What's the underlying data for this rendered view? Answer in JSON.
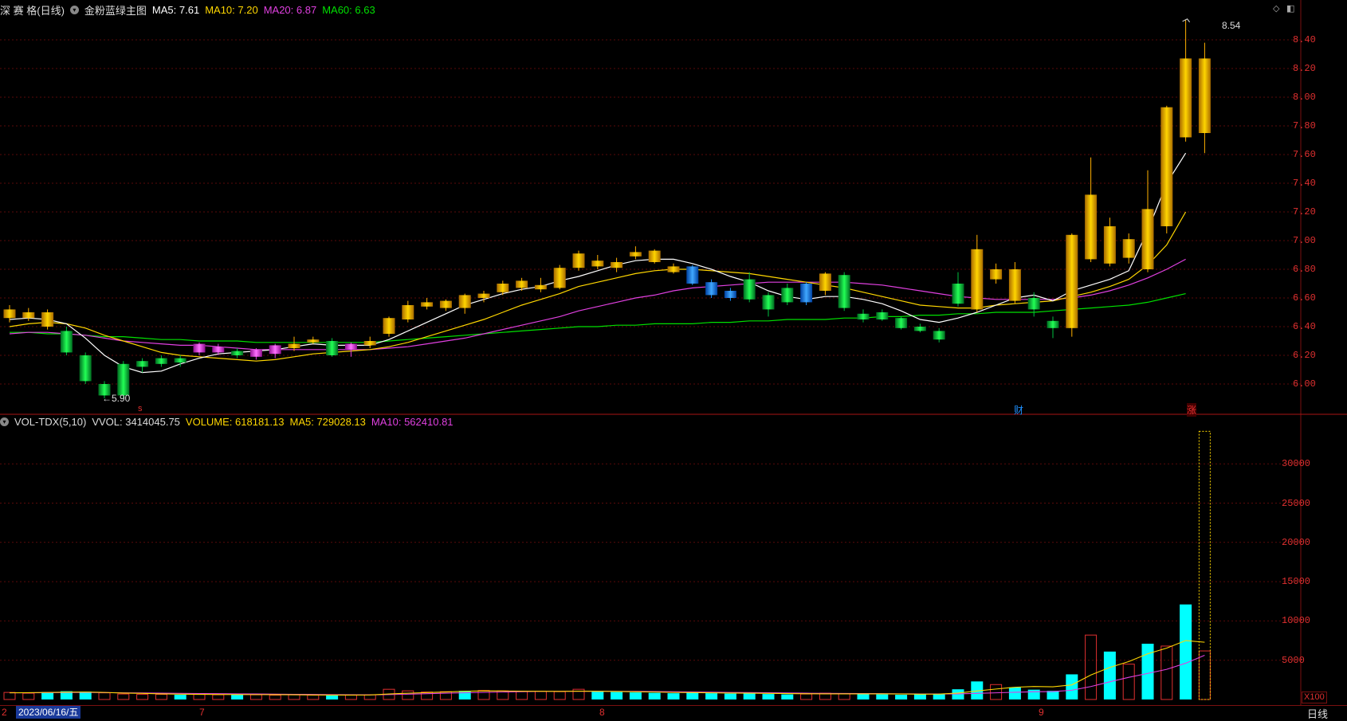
{
  "header": {
    "stock_name": "深 赛 格",
    "period_tag": "(日线)",
    "indicator_name": "金粉蓝绿主图",
    "ma5": "MA5: 7.61",
    "ma10": "MA10: 7.20",
    "ma20": "MA20: 6.87",
    "ma60": "MA60: 6.63"
  },
  "volume_header": {
    "name": "VOL-TDX(5,10)",
    "vvol": "VVOL: 3414045.75",
    "volume": "VOLUME: 618181.13",
    "ma5": "MA5: 729028.13",
    "ma10": "MA10: 562410.81"
  },
  "price_axis": [
    "8.40",
    "8.20",
    "8.00",
    "7.80",
    "7.60",
    "7.40",
    "7.20",
    "7.00",
    "6.80",
    "6.60",
    "6.40",
    "6.20",
    "6.00"
  ],
  "volume_axis": [
    "30000",
    "25000",
    "20000",
    "15000",
    "10000",
    "5000"
  ],
  "annotations": {
    "high": "8.54",
    "low": "←5.90"
  },
  "markers": {
    "m1": "s",
    "m2": "财",
    "m3": "涨"
  },
  "bottom": {
    "date": "2023/06/16/五",
    "x_first": "2",
    "x_jul": "7",
    "x_aug": "8",
    "x_sep": "9",
    "period": "日线",
    "unit": "X100"
  },
  "colors": {
    "up_gold": "#ffb000",
    "down_green": "#00c040",
    "blue": "#1e90ff",
    "magenta": "#e040e0",
    "cyan": "#00ffff",
    "grid": "#5a0a0a",
    "axis": "#e03030"
  },
  "chart_data": [
    {
      "type": "candlestick",
      "title": "深 赛 格(日线)",
      "ylim": [
        5.8,
        8.6
      ],
      "candles": [
        [
          "gold",
          6.52,
          6.46,
          6.55,
          6.43
        ],
        [
          "gold",
          6.5,
          6.46,
          6.53,
          6.44
        ],
        [
          "gold",
          6.5,
          6.4,
          6.52,
          6.38
        ],
        [
          "green",
          6.37,
          6.22,
          6.4,
          6.2
        ],
        [
          "green",
          6.2,
          6.02,
          6.22,
          6.0
        ],
        [
          "green",
          6.0,
          5.92,
          6.02,
          5.9
        ],
        [
          "green",
          6.14,
          5.92,
          6.16,
          5.9
        ],
        [
          "green",
          6.16,
          6.12,
          6.18,
          6.08
        ],
        [
          "green",
          6.18,
          6.14,
          6.2,
          6.12
        ],
        [
          "green",
          6.18,
          6.15,
          6.2,
          6.12
        ],
        [
          "magenta",
          6.22,
          6.28,
          6.29,
          6.2
        ],
        [
          "magenta",
          6.22,
          6.26,
          6.28,
          6.2
        ],
        [
          "green",
          6.23,
          6.2,
          6.25,
          6.18
        ],
        [
          "magenta",
          6.19,
          6.24,
          6.25,
          6.17
        ],
        [
          "magenta",
          6.21,
          6.27,
          6.28,
          6.18
        ],
        [
          "gold",
          6.25,
          6.28,
          6.33,
          6.23
        ],
        [
          "gold",
          6.29,
          6.31,
          6.33,
          6.28
        ],
        [
          "green",
          6.3,
          6.2,
          6.32,
          6.19
        ],
        [
          "magenta",
          6.24,
          6.28,
          6.29,
          6.19
        ],
        [
          "gold",
          6.27,
          6.3,
          6.33,
          6.25
        ],
        [
          "gold",
          6.35,
          6.46,
          6.47,
          6.33
        ],
        [
          "gold",
          6.45,
          6.55,
          6.58,
          6.43
        ],
        [
          "gold",
          6.54,
          6.57,
          6.6,
          6.52
        ],
        [
          "gold",
          6.53,
          6.58,
          6.59,
          6.51
        ],
        [
          "gold",
          6.53,
          6.62,
          6.63,
          6.49
        ],
        [
          "gold",
          6.6,
          6.63,
          6.65,
          6.57
        ],
        [
          "gold",
          6.64,
          6.7,
          6.72,
          6.62
        ],
        [
          "gold",
          6.67,
          6.72,
          6.74,
          6.65
        ],
        [
          "gold",
          6.66,
          6.69,
          6.74,
          6.64
        ],
        [
          "gold",
          6.67,
          6.81,
          6.83,
          6.66
        ],
        [
          "gold",
          6.81,
          6.91,
          6.93,
          6.79
        ],
        [
          "gold",
          6.82,
          6.86,
          6.9,
          6.8
        ],
        [
          "gold",
          6.81,
          6.85,
          6.88,
          6.78
        ],
        [
          "gold",
          6.89,
          6.92,
          6.96,
          6.87
        ],
        [
          "gold",
          6.85,
          6.93,
          6.94,
          6.84
        ],
        [
          "gold",
          6.78,
          6.82,
          6.84,
          6.77
        ],
        [
          "blue",
          6.82,
          6.7,
          6.83,
          6.69
        ],
        [
          "blue",
          6.71,
          6.62,
          6.73,
          6.6
        ],
        [
          "blue",
          6.65,
          6.6,
          6.67,
          6.58
        ],
        [
          "green",
          6.73,
          6.59,
          6.78,
          6.57
        ],
        [
          "green",
          6.62,
          6.52,
          6.64,
          6.47
        ],
        [
          "green",
          6.67,
          6.57,
          6.7,
          6.55
        ],
        [
          "blue",
          6.7,
          6.57,
          6.71,
          6.55
        ],
        [
          "gold",
          6.65,
          6.77,
          6.78,
          6.62
        ],
        [
          "green",
          6.76,
          6.53,
          6.78,
          6.51
        ],
        [
          "green",
          6.49,
          6.45,
          6.52,
          6.43
        ],
        [
          "green",
          6.5,
          6.45,
          6.52,
          6.44
        ],
        [
          "green",
          6.46,
          6.39,
          6.47,
          6.38
        ],
        [
          "green",
          6.4,
          6.37,
          6.42,
          6.36
        ],
        [
          "green",
          6.37,
          6.31,
          6.39,
          6.29
        ],
        [
          "green",
          6.7,
          6.56,
          6.78,
          6.54
        ],
        [
          "gold",
          6.52,
          6.94,
          7.04,
          6.5
        ],
        [
          "gold",
          6.73,
          6.8,
          6.84,
          6.7
        ],
        [
          "gold",
          6.58,
          6.8,
          6.85,
          6.56
        ],
        [
          "green",
          6.6,
          6.52,
          6.64,
          6.47
        ],
        [
          "green",
          6.44,
          6.39,
          6.47,
          6.32
        ],
        [
          "gold",
          6.39,
          7.04,
          7.05,
          6.33
        ],
        [
          "gold",
          6.87,
          7.32,
          7.58,
          6.85
        ],
        [
          "gold",
          6.84,
          7.1,
          7.16,
          6.82
        ],
        [
          "gold",
          6.88,
          7.01,
          7.05,
          6.84
        ],
        [
          "gold",
          6.8,
          7.22,
          7.49,
          6.78
        ],
        [
          "gold",
          7.1,
          7.93,
          7.94,
          7.05
        ],
        [
          "gold",
          7.72,
          8.27,
          8.54,
          7.69
        ],
        [
          "gold",
          7.75,
          8.27,
          8.38,
          7.61
        ]
      ],
      "ma5": [
        6.45,
        6.46,
        6.45,
        6.42,
        6.32,
        6.2,
        6.12,
        6.08,
        6.09,
        6.14,
        6.18,
        6.21,
        6.22,
        6.23,
        6.24,
        6.26,
        6.28,
        6.27,
        6.27,
        6.27,
        6.31,
        6.37,
        6.43,
        6.49,
        6.55,
        6.59,
        6.63,
        6.66,
        6.68,
        6.72,
        6.75,
        6.79,
        6.83,
        6.86,
        6.87,
        6.87,
        6.84,
        6.8,
        6.75,
        6.71,
        6.65,
        6.61,
        6.59,
        6.61,
        6.61,
        6.59,
        6.56,
        6.51,
        6.45,
        6.43,
        6.46,
        6.5,
        6.55,
        6.6,
        6.62,
        6.58,
        6.65,
        6.69,
        6.73,
        6.79,
        7.07,
        7.4,
        7.61
      ],
      "ma10": [
        6.4,
        6.42,
        6.43,
        6.42,
        6.39,
        6.34,
        6.3,
        6.26,
        6.22,
        6.2,
        6.19,
        6.18,
        6.17,
        6.16,
        6.17,
        6.19,
        6.21,
        6.22,
        6.23,
        6.24,
        6.26,
        6.29,
        6.33,
        6.37,
        6.41,
        6.45,
        6.5,
        6.55,
        6.59,
        6.63,
        6.68,
        6.71,
        6.74,
        6.77,
        6.79,
        6.8,
        6.8,
        6.79,
        6.78,
        6.77,
        6.75,
        6.73,
        6.71,
        6.69,
        6.67,
        6.64,
        6.61,
        6.58,
        6.55,
        6.54,
        6.53,
        6.53,
        6.55,
        6.56,
        6.57,
        6.58,
        6.61,
        6.64,
        6.68,
        6.73,
        6.83,
        6.97,
        7.2
      ],
      "ma20": [
        6.35,
        6.36,
        6.36,
        6.35,
        6.34,
        6.32,
        6.3,
        6.29,
        6.28,
        6.27,
        6.27,
        6.26,
        6.25,
        6.24,
        6.24,
        6.24,
        6.24,
        6.24,
        6.24,
        6.24,
        6.25,
        6.26,
        6.28,
        6.3,
        6.32,
        6.35,
        6.38,
        6.41,
        6.44,
        6.47,
        6.51,
        6.54,
        6.57,
        6.6,
        6.62,
        6.65,
        6.67,
        6.68,
        6.69,
        6.7,
        6.71,
        6.71,
        6.71,
        6.71,
        6.71,
        6.7,
        6.69,
        6.67,
        6.65,
        6.63,
        6.61,
        6.6,
        6.59,
        6.59,
        6.59,
        6.59,
        6.6,
        6.62,
        6.65,
        6.69,
        6.74,
        6.8,
        6.87
      ],
      "ma60": [
        6.36,
        6.36,
        6.35,
        6.35,
        6.34,
        6.33,
        6.33,
        6.32,
        6.31,
        6.31,
        6.3,
        6.3,
        6.3,
        6.29,
        6.29,
        6.29,
        6.29,
        6.29,
        6.29,
        6.29,
        6.3,
        6.31,
        6.32,
        6.33,
        6.34,
        6.35,
        6.36,
        6.37,
        6.38,
        6.39,
        6.4,
        6.4,
        6.41,
        6.41,
        6.42,
        6.42,
        6.42,
        6.43,
        6.43,
        6.44,
        6.44,
        6.45,
        6.45,
        6.45,
        6.46,
        6.46,
        6.47,
        6.47,
        6.48,
        6.48,
        6.49,
        6.49,
        6.5,
        6.5,
        6.5,
        6.51,
        6.52,
        6.53,
        6.54,
        6.55,
        6.57,
        6.6,
        6.63
      ]
    },
    {
      "type": "bar",
      "title": "VOL-TDX(5,10)",
      "ylim": [
        0,
        35000
      ],
      "volumes": [
        900,
        800,
        950,
        1050,
        1000,
        850,
        700,
        650,
        650,
        600,
        650,
        600,
        650,
        600,
        550,
        600,
        550,
        500,
        550,
        600,
        1300,
        1100,
        950,
        1000,
        1100,
        1150,
        1100,
        1050,
        1050,
        1000,
        1300,
        1000,
        950,
        900,
        850,
        800,
        900,
        800,
        750,
        800,
        700,
        650,
        700,
        800,
        750,
        700,
        650,
        600,
        700,
        750,
        1300,
        2300,
        1900,
        1550,
        1250,
        1100,
        3200,
        8200,
        6100,
        4500,
        7100,
        6800,
        12100,
        6182
      ],
      "volume_colors": [
        "hollow",
        "hollow",
        "cyan",
        "cyan",
        "cyan",
        "hollow",
        "hollow",
        "hollow",
        "hollow",
        "cyan",
        "hollow",
        "hollow",
        "cyan",
        "hollow",
        "hollow",
        "hollow",
        "hollow",
        "cyan",
        "hollow",
        "hollow",
        "hollow",
        "hollow",
        "hollow",
        "hollow",
        "cyan",
        "hollow",
        "hollow",
        "hollow",
        "hollow",
        "hollow",
        "hollow",
        "cyan",
        "cyan",
        "cyan",
        "cyan",
        "cyan",
        "cyan",
        "cyan",
        "cyan",
        "cyan",
        "cyan",
        "cyan",
        "hollow",
        "hollow",
        "hollow",
        "cyan",
        "cyan",
        "cyan",
        "cyan",
        "cyan",
        "cyan",
        "cyan",
        "hollow",
        "cyan",
        "cyan",
        "cyan",
        "cyan",
        "hollow",
        "cyan",
        "hollow",
        "cyan",
        "hollow",
        "cyan",
        "hollow"
      ],
      "vvol": 34140,
      "ma5": [
        850,
        870,
        900,
        930,
        950,
        900,
        820,
        780,
        720,
        680,
        650,
        640,
        630,
        620,
        610,
        600,
        580,
        560,
        560,
        580,
        700,
        800,
        880,
        960,
        1050,
        1100,
        1080,
        1060,
        1050,
        1030,
        1060,
        1050,
        1020,
        980,
        950,
        900,
        880,
        850,
        820,
        800,
        780,
        750,
        730,
        720,
        720,
        720,
        720,
        700,
        680,
        690,
        820,
        1080,
        1330,
        1560,
        1650,
        1620,
        1860,
        3120,
        4080,
        4830,
        5820,
        6540,
        7500,
        7290
      ],
      "ma10": [
        850,
        860,
        870,
        890,
        900,
        880,
        850,
        830,
        800,
        780,
        760,
        740,
        720,
        700,
        680,
        660,
        640,
        620,
        600,
        590,
        620,
        680,
        740,
        800,
        850,
        900,
        950,
        1000,
        1030,
        1040,
        1050,
        1050,
        1040,
        1030,
        1010,
        990,
        960,
        930,
        900,
        880,
        860,
        830,
        800,
        780,
        770,
        760,
        740,
        720,
        710,
        700,
        720,
        780,
        850,
        920,
        980,
        1010,
        1180,
        1650,
        2250,
        2820,
        3320,
        3840,
        4620,
        5624
      ]
    }
  ]
}
